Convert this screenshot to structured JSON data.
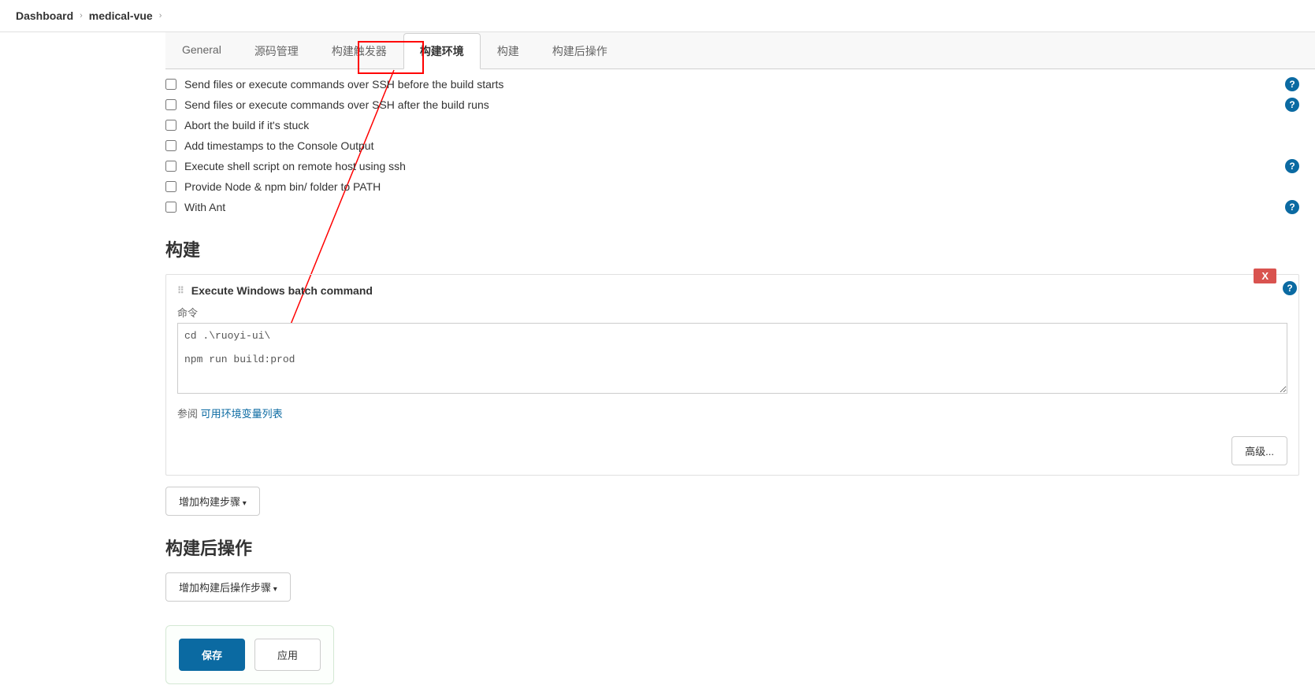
{
  "breadcrumb": {
    "items": [
      "Dashboard",
      "medical-vue"
    ]
  },
  "tabs": {
    "items": [
      {
        "label": "General",
        "active": false
      },
      {
        "label": "源码管理",
        "active": false
      },
      {
        "label": "构建触发器",
        "active": false
      },
      {
        "label": "构建环境",
        "active": true
      },
      {
        "label": "构建",
        "active": false
      },
      {
        "label": "构建后操作",
        "active": false
      }
    ]
  },
  "build_env": {
    "checkboxes": [
      {
        "label": "Send files or execute commands over SSH before the build starts",
        "help": true
      },
      {
        "label": "Send files or execute commands over SSH after the build runs",
        "help": true
      },
      {
        "label": "Abort the build if it's stuck",
        "help": false
      },
      {
        "label": "Add timestamps to the Console Output",
        "help": false
      },
      {
        "label": "Execute shell script on remote host using ssh",
        "help": true
      },
      {
        "label": "Provide Node & npm bin/ folder to PATH",
        "help": false
      },
      {
        "label": "With Ant",
        "help": true
      }
    ]
  },
  "build_section": {
    "title": "构建",
    "step": {
      "name": "Execute Windows batch command",
      "command_label": "命令",
      "command_value": "cd .\\ruoyi-ui\\\n\nnpm run build:prod",
      "see_prefix": "参阅 ",
      "see_link": "可用环境变量列表",
      "delete_label": "X",
      "advanced_label": "高级..."
    },
    "add_step_label": "增加构建步骤"
  },
  "post_build": {
    "title": "构建后操作",
    "add_step_label": "增加构建后操作步骤"
  },
  "footer": {
    "save_label": "保存",
    "apply_label": "应用"
  }
}
